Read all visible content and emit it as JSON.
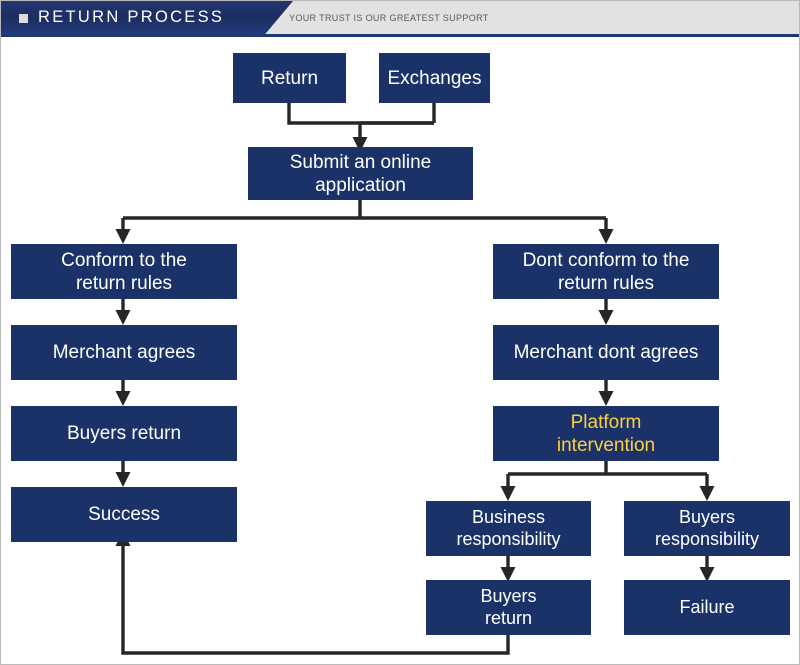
{
  "header": {
    "bullet_icon": "square-bullet-icon",
    "title": "RETURN PROCESS",
    "tagline": "YOUR TRUST IS OUR GREATEST SUPPORT",
    "brand_color": "#1b3269",
    "strip_color": "#e2e2e2"
  },
  "theme": {
    "node_fill": "#1b3269",
    "node_text": "#ffffff",
    "accent_text": "#ffcf3d",
    "connector": "#262626",
    "background": "#ffffff"
  },
  "flowchart": {
    "title": "Return Process",
    "nodes": [
      {
        "id": "return",
        "label_line1": "Return",
        "label_line2": "",
        "accent": false
      },
      {
        "id": "exchanges",
        "label_line1": "Exchanges",
        "label_line2": "",
        "accent": false
      },
      {
        "id": "submit",
        "label_line1": "Submit an online",
        "label_line2": "application",
        "accent": false
      },
      {
        "id": "conform",
        "label_line1": "Conform to the",
        "label_line2": "return rules",
        "accent": false
      },
      {
        "id": "dont-conform",
        "label_line1": "Dont conform to the",
        "label_line2": "return rules",
        "accent": false
      },
      {
        "id": "merchant-agrees",
        "label_line1": "Merchant agrees",
        "label_line2": "",
        "accent": false
      },
      {
        "id": "merchant-dont-agrees",
        "label_line1": "Merchant dont agrees",
        "label_line2": "",
        "accent": false
      },
      {
        "id": "buyers-return-left",
        "label_line1": "Buyers return",
        "label_line2": "",
        "accent": false
      },
      {
        "id": "platform-intervention",
        "label_line1": "Platform",
        "label_line2": "intervention",
        "accent": true
      },
      {
        "id": "success",
        "label_line1": "Success",
        "label_line2": "",
        "accent": false
      },
      {
        "id": "business-responsibility",
        "label_line1": "Business",
        "label_line2": "responsibility",
        "accent": false
      },
      {
        "id": "buyers-responsibility",
        "label_line1": "Buyers",
        "label_line2": "responsibility",
        "accent": false
      },
      {
        "id": "buyers-return-right",
        "label_line1": "Buyers",
        "label_line2": "return",
        "accent": false
      },
      {
        "id": "failure",
        "label_line1": "Failure",
        "label_line2": "",
        "accent": false
      }
    ],
    "edges": [
      {
        "from": "return",
        "to": "submit"
      },
      {
        "from": "exchanges",
        "to": "submit"
      },
      {
        "from": "submit",
        "to": "conform"
      },
      {
        "from": "submit",
        "to": "dont-conform"
      },
      {
        "from": "conform",
        "to": "merchant-agrees"
      },
      {
        "from": "merchant-agrees",
        "to": "buyers-return-left"
      },
      {
        "from": "buyers-return-left",
        "to": "success"
      },
      {
        "from": "dont-conform",
        "to": "merchant-dont-agrees"
      },
      {
        "from": "merchant-dont-agrees",
        "to": "platform-intervention"
      },
      {
        "from": "platform-intervention",
        "to": "business-responsibility"
      },
      {
        "from": "platform-intervention",
        "to": "buyers-responsibility"
      },
      {
        "from": "business-responsibility",
        "to": "buyers-return-right"
      },
      {
        "from": "buyers-responsibility",
        "to": "failure"
      },
      {
        "from": "buyers-return-right",
        "to": "success"
      }
    ]
  }
}
